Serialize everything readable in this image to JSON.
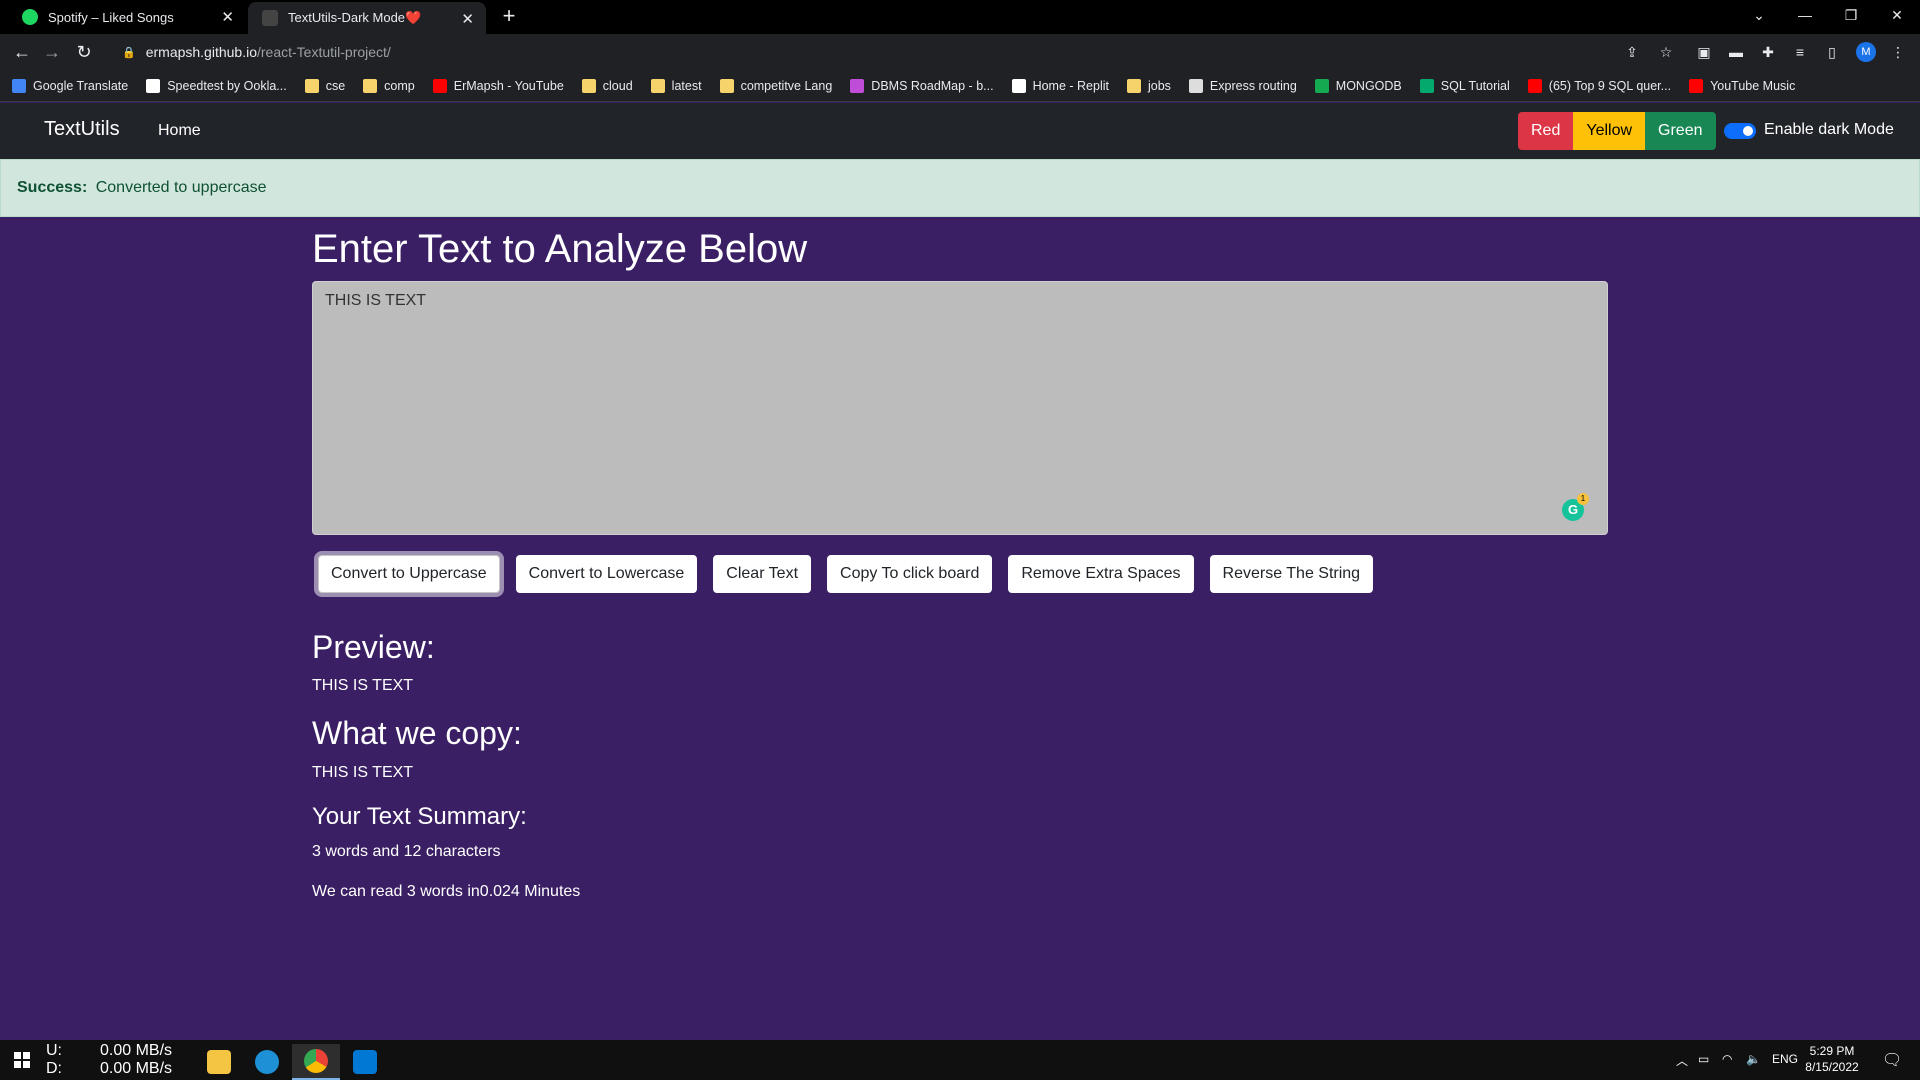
{
  "browser": {
    "tabs": [
      {
        "label": "Spotify – Liked Songs",
        "active": false
      },
      {
        "label": "TextUtils-Dark Mode❤️",
        "active": true
      }
    ],
    "url_host": "ermapsh.github.io",
    "url_path": "/react-Textutil-project/",
    "bookmarks": [
      {
        "label": "Google Translate",
        "icon": "translate-icon",
        "color": "#4285f4"
      },
      {
        "label": "Speedtest by Ookla...",
        "icon": "speedtest-icon",
        "color": "#ffffff"
      },
      {
        "label": "cse",
        "icon": "folder-icon",
        "color": "#f6d36b"
      },
      {
        "label": "comp",
        "icon": "folder-icon",
        "color": "#f6d36b"
      },
      {
        "label": "ErMapsh - YouTube",
        "icon": "youtube-icon",
        "color": "#ff0000"
      },
      {
        "label": "cloud",
        "icon": "folder-icon",
        "color": "#f6d36b"
      },
      {
        "label": "latest",
        "icon": "folder-icon",
        "color": "#f6d36b"
      },
      {
        "label": "competitve Lang",
        "icon": "folder-icon",
        "color": "#f6d36b"
      },
      {
        "label": "DBMS RoadMap - b...",
        "icon": "roadmap-icon",
        "color": "#c04dd8"
      },
      {
        "label": "Home - Replit",
        "icon": "replit-icon",
        "color": "#ffffff"
      },
      {
        "label": "jobs",
        "icon": "folder-icon",
        "color": "#f6d36b"
      },
      {
        "label": "Express routing",
        "icon": "express-icon",
        "color": "#dddddd"
      },
      {
        "label": "MONGODB",
        "icon": "mongodb-icon",
        "color": "#13aa52"
      },
      {
        "label": "SQL Tutorial",
        "icon": "w3schools-icon",
        "color": "#04aa6d"
      },
      {
        "label": "(65) Top 9 SQL quer...",
        "icon": "youtube-icon",
        "color": "#ff0000"
      },
      {
        "label": "YouTube Music",
        "icon": "youtube-music-icon",
        "color": "#ff0000"
      }
    ]
  },
  "navbar": {
    "brand": "TextUtils",
    "home": "Home",
    "colors": [
      "Red",
      "Yellow",
      "Green"
    ],
    "dark_mode_label": "Enable dark Mode",
    "dark_mode_on": true
  },
  "alert": {
    "type": "Success:",
    "message": "Converted to uppercase"
  },
  "main": {
    "heading": "Enter Text to Analyze Below",
    "textarea_value": "THIS IS TEXT",
    "grammarly_count": "1",
    "buttons": [
      "Convert to Uppercase",
      "Convert to Lowercase",
      "Clear Text",
      "Copy To click board",
      "Remove Extra Spaces",
      "Reverse The String"
    ],
    "preview_heading": "Preview:",
    "preview_text": "THIS IS TEXT",
    "copy_heading": "What we copy:",
    "copy_text": "THIS IS TEXT",
    "summary_heading": "Your Text Summary:",
    "summary_counts": "3 words and 12 characters",
    "read_time": "We can read 3 words in0.024 Minutes"
  },
  "taskbar": {
    "upload_label": "U:",
    "upload_value": "0.00 MB/s",
    "download_label": "D:",
    "download_value": "0.00 MB/s",
    "language": "ENG",
    "time": "5:29 PM",
    "date": "8/15/2022"
  },
  "colors": {
    "page_bg": "#3a1f64",
    "navbar_bg": "#212529",
    "alert_bg": "#d1e7dd",
    "red": "#dc3545",
    "yellow": "#ffc107",
    "green": "#198754"
  }
}
